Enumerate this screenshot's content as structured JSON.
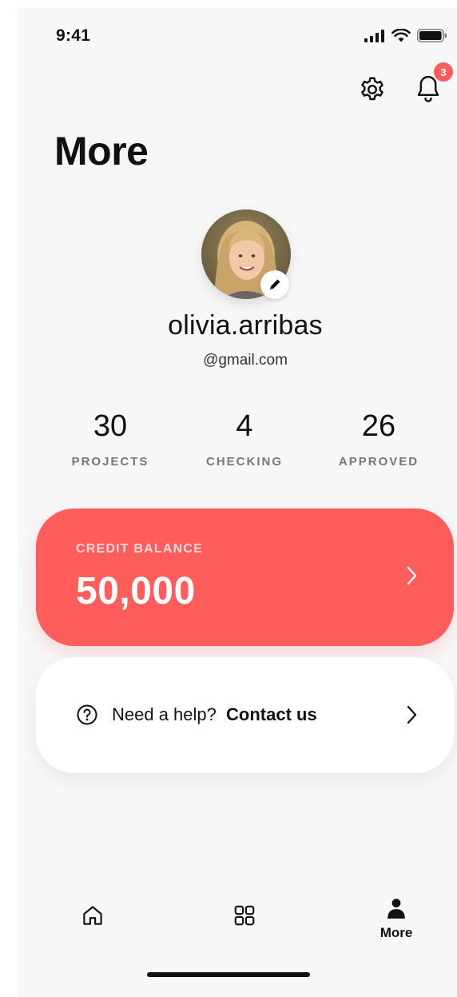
{
  "status_bar": {
    "time": "9:41"
  },
  "header": {
    "notification_count": "3"
  },
  "page": {
    "title": "More"
  },
  "profile": {
    "username": "olivia.arribas",
    "email": "@gmail.com"
  },
  "stats": [
    {
      "value": "30",
      "label": "PROJECTS"
    },
    {
      "value": "4",
      "label": "CHECKING"
    },
    {
      "value": "26",
      "label": "APPROVED"
    }
  ],
  "credit": {
    "label": "CREDIT BALANCE",
    "amount": "50,000"
  },
  "help": {
    "question": "Need a help?",
    "link": "Contact us"
  },
  "tab_bar": {
    "tabs": [
      {
        "icon": "home-icon",
        "label": ""
      },
      {
        "icon": "grid-icon",
        "label": ""
      },
      {
        "icon": "person-icon",
        "label": "More"
      }
    ]
  },
  "colors": {
    "accent": "#ff5c5c",
    "background": "#f7f7f7",
    "card": "#ffffff"
  }
}
